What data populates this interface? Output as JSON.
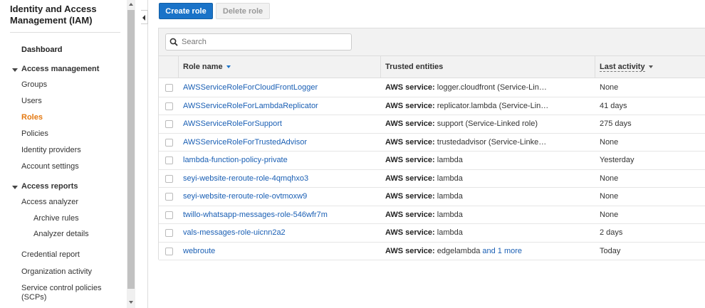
{
  "sidebar": {
    "title": "Identity and Access Management (IAM)",
    "dashboard": "Dashboard",
    "access_management": "Access management",
    "groups": "Groups",
    "users": "Users",
    "roles": "Roles",
    "policies": "Policies",
    "identity_providers": "Identity providers",
    "account_settings": "Account settings",
    "access_reports": "Access reports",
    "access_analyzer": "Access analyzer",
    "archive_rules": "Archive rules",
    "analyzer_details": "Analyzer details",
    "credential_report": "Credential report",
    "organization_activity": "Organization activity",
    "scp_line1": "Service control policies",
    "scp_line2": "(SCPs)"
  },
  "toolbar": {
    "create_role": "Create role",
    "delete_role": "Delete role"
  },
  "search": {
    "placeholder": "Search"
  },
  "table": {
    "headers": {
      "role_name": "Role name",
      "trusted_entities": "Trusted entities",
      "last_activity": "Last activity"
    },
    "rows": [
      {
        "name": "AWSServiceRoleForCloudFrontLogger",
        "trust_label": "AWS service:",
        "trust_value": "logger.cloudfront (Service-Link…",
        "more": "",
        "last": "None"
      },
      {
        "name": "AWSServiceRoleForLambdaReplicator",
        "trust_label": "AWS service:",
        "trust_value": "replicator.lambda (Service-Link…",
        "more": "",
        "last": "41 days"
      },
      {
        "name": "AWSServiceRoleForSupport",
        "trust_label": "AWS service:",
        "trust_value": "support (Service-Linked role)",
        "more": "",
        "last": "275 days"
      },
      {
        "name": "AWSServiceRoleForTrustedAdvisor",
        "trust_label": "AWS service:",
        "trust_value": "trustedadvisor (Service-Linked …",
        "more": "",
        "last": "None"
      },
      {
        "name": "lambda-function-policy-private",
        "trust_label": "AWS service:",
        "trust_value": "lambda",
        "more": "",
        "last": "Yesterday"
      },
      {
        "name": "seyi-website-reroute-role-4qmqhxo3",
        "trust_label": "AWS service:",
        "trust_value": "lambda",
        "more": "",
        "last": "None"
      },
      {
        "name": "seyi-website-reroute-role-ovtmoxw9",
        "trust_label": "AWS service:",
        "trust_value": "lambda",
        "more": "",
        "last": "None"
      },
      {
        "name": "twillo-whatsapp-messages-role-546wfr7m",
        "trust_label": "AWS service:",
        "trust_value": "lambda",
        "more": "",
        "last": "None"
      },
      {
        "name": "vals-messages-role-uicnn2a2",
        "trust_label": "AWS service:",
        "trust_value": "lambda",
        "more": "",
        "last": "2 days"
      },
      {
        "name": "webroute",
        "trust_label": "AWS service:",
        "trust_value": "edgelambda",
        "more": "and 1 more",
        "last": "Today"
      }
    ]
  },
  "colors": {
    "link": "#1a5fb4",
    "primary_button": "#1a73c8",
    "active_nav": "#e47911"
  }
}
